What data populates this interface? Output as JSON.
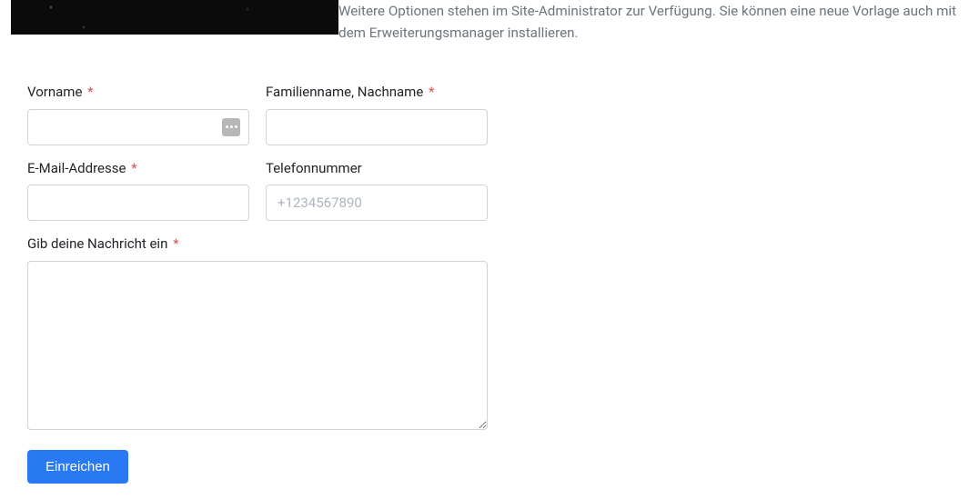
{
  "intro": "Weitere Optionen stehen im Site-Administrator zur Verfügung. Sie können eine neue Vorlage auch mit dem Erweiterungsmanager installieren.",
  "form": {
    "first_name": {
      "label": "Vorname",
      "required": true,
      "value": ""
    },
    "last_name": {
      "label": "Familienname, Nachname",
      "required": true,
      "value": ""
    },
    "email": {
      "label": "E-Mail-Addresse",
      "required": true,
      "value": ""
    },
    "phone": {
      "label": "Telefonnummer",
      "required": false,
      "placeholder": "+1234567890",
      "value": ""
    },
    "message": {
      "label": "Gib deine Nachricht ein",
      "required": true,
      "value": ""
    },
    "submit_label": "Einreichen",
    "required_marker": "*"
  }
}
